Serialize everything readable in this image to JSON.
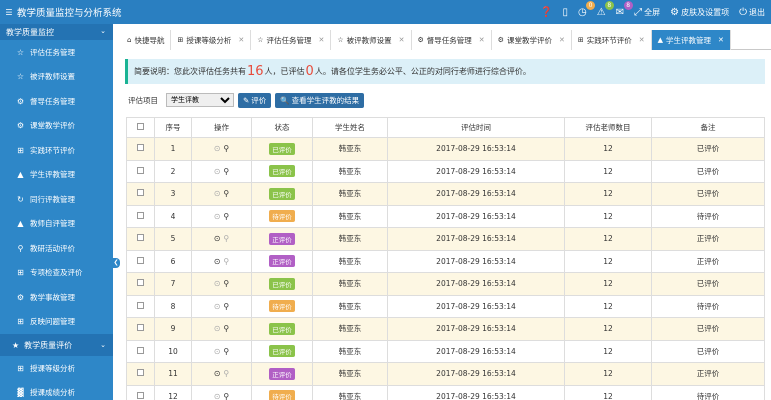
{
  "app": {
    "title": "教学质量监控与分析系统"
  },
  "topbar": {
    "msg_badge": "0",
    "bell_badge": "8",
    "mail_badge": "8",
    "fullscreen_label": "全屏",
    "skin_label": "皮肤及设置项",
    "logout_label": "退出",
    "badge_colors": {
      "msg": "#f0ad4e",
      "bell": "#8bc34a",
      "mail": "#b15fc5"
    }
  },
  "sidebar": {
    "section1": "教学质量监控",
    "items": [
      {
        "label": "评估任务管理",
        "icon": "star-outline-icon"
      },
      {
        "label": "被评教师设置",
        "icon": "star-outline-icon"
      },
      {
        "label": "督导任务管理",
        "icon": "gear-icon"
      },
      {
        "label": "课堂教学评价",
        "icon": "gear-icon"
      },
      {
        "label": "实践环节评价",
        "icon": "grid-icon"
      },
      {
        "label": "学生评教管理",
        "icon": "road-icon"
      },
      {
        "label": "同行评教管理",
        "icon": "refresh-icon"
      },
      {
        "label": "教师自评管理",
        "icon": "road-icon"
      },
      {
        "label": "教研活动评价",
        "icon": "search-icon"
      },
      {
        "label": "专项检查及评价",
        "icon": "grid-icon"
      },
      {
        "label": "教学事故管理",
        "icon": "gear-icon"
      },
      {
        "label": "反映问题管理",
        "icon": "grid-icon"
      }
    ],
    "section2": "教学质量评价",
    "items2": [
      {
        "label": "授课等级分析",
        "icon": "grid-icon"
      },
      {
        "label": "授课成绩分析",
        "icon": "chart-icon"
      }
    ]
  },
  "tabs": [
    {
      "label": "快捷导航",
      "icon": "home-icon"
    },
    {
      "label": "授课等级分析",
      "icon": "grid-icon"
    },
    {
      "label": "评估任务管理",
      "icon": "star-outline-icon"
    },
    {
      "label": "被评教师设置",
      "icon": "star-outline-icon"
    },
    {
      "label": "督导任务管理",
      "icon": "gear-icon"
    },
    {
      "label": "课堂教学评价",
      "icon": "gear-icon"
    },
    {
      "label": "实践环节评价",
      "icon": "grid-icon"
    },
    {
      "label": "学生评教管理",
      "icon": "road-icon",
      "active": true
    }
  ],
  "notice": {
    "prefix": "简要说明：您此次评估任务共有",
    "total": "16",
    "mid": "人，已评估",
    "done": "0",
    "suffix": "人。请各位学生务必公平、公正的对同行老师进行综合评价。"
  },
  "filter": {
    "label": "评估项目",
    "selected": "学生评教",
    "eval_button": "评价",
    "view_button": "查看学生评教的结果"
  },
  "table": {
    "headers": [
      "",
      "序号",
      "操作",
      "状态",
      "学生姓名",
      "评估时间",
      "评估老师数目",
      "备注"
    ],
    "status_colors": {
      "已评价": "#8bc34a",
      "待评价": "#f0ad4e",
      "正评价": "#b15fc5"
    },
    "rows": [
      {
        "no": "1",
        "status": "已评价",
        "name": "韩亚东",
        "time": "2017-08-29 16:53:14",
        "count": "12",
        "remark": "已评价",
        "op": "search"
      },
      {
        "no": "2",
        "status": "已评价",
        "name": "韩亚东",
        "time": "2017-08-29 16:53:14",
        "count": "12",
        "remark": "已评价",
        "op": "search"
      },
      {
        "no": "3",
        "status": "已评价",
        "name": "韩亚东",
        "time": "2017-08-29 16:53:14",
        "count": "12",
        "remark": "已评价",
        "op": "search"
      },
      {
        "no": "4",
        "status": "待评价",
        "name": "韩亚东",
        "time": "2017-08-29 16:53:14",
        "count": "12",
        "remark": "待评价",
        "op": "search"
      },
      {
        "no": "5",
        "status": "正评价",
        "name": "韩亚东",
        "time": "2017-08-29 16:53:14",
        "count": "12",
        "remark": "正评价",
        "op": "check"
      },
      {
        "no": "6",
        "status": "正评价",
        "name": "韩亚东",
        "time": "2017-08-29 16:53:14",
        "count": "12",
        "remark": "正评价",
        "op": "check"
      },
      {
        "no": "7",
        "status": "已评价",
        "name": "韩亚东",
        "time": "2017-08-29 16:53:14",
        "count": "12",
        "remark": "已评价",
        "op": "search"
      },
      {
        "no": "8",
        "status": "待评价",
        "name": "韩亚东",
        "time": "2017-08-29 16:53:14",
        "count": "12",
        "remark": "待评价",
        "op": "search"
      },
      {
        "no": "9",
        "status": "已评价",
        "name": "韩亚东",
        "time": "2017-08-29 16:53:14",
        "count": "12",
        "remark": "已评价",
        "op": "search"
      },
      {
        "no": "10",
        "status": "已评价",
        "name": "韩亚东",
        "time": "2017-08-29 16:53:14",
        "count": "12",
        "remark": "已评价",
        "op": "search"
      },
      {
        "no": "11",
        "status": "正评价",
        "name": "韩亚东",
        "time": "2017-08-29 16:53:14",
        "count": "12",
        "remark": "正评价",
        "op": "check"
      },
      {
        "no": "12",
        "status": "待评价",
        "name": "韩亚东",
        "time": "2017-08-29 16:53:14",
        "count": "12",
        "remark": "待评价",
        "op": "search"
      }
    ]
  }
}
